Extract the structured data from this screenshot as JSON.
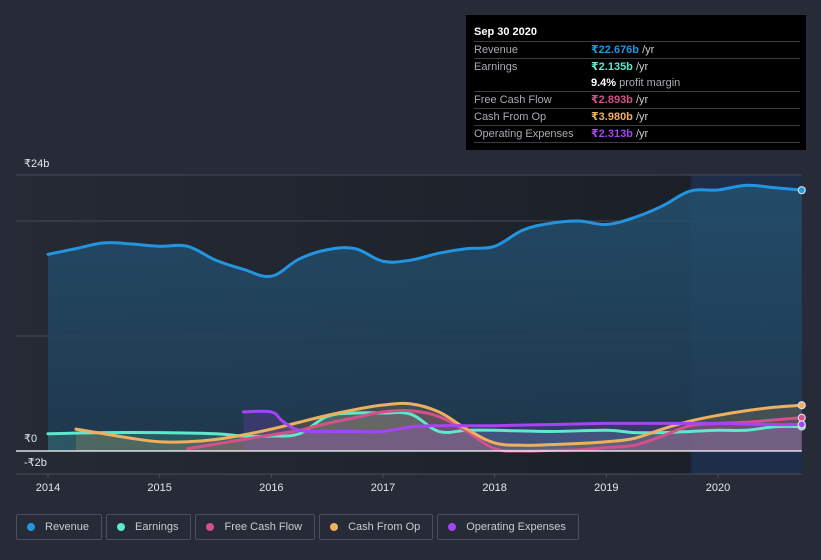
{
  "tooltip": {
    "date": "Sep 30 2020",
    "rows": [
      {
        "label": "Revenue",
        "value": "₹22.676b",
        "unit": " /yr",
        "color": "#2394df"
      },
      {
        "label": "Earnings",
        "value": "₹2.135b",
        "unit": " /yr",
        "color": "#5ee8cc"
      },
      {
        "label": "",
        "value": "9.4%",
        "unit": " profit margin",
        "color": "#ffffff"
      },
      {
        "label": "Free Cash Flow",
        "value": "₹2.893b",
        "unit": " /yr",
        "color": "#d3508d"
      },
      {
        "label": "Cash From Op",
        "value": "₹3.980b",
        "unit": " /yr",
        "color": "#eeaf5f"
      },
      {
        "label": "Operating Expenses",
        "value": "₹2.313b",
        "unit": " /yr",
        "color": "#a544f0"
      }
    ]
  },
  "legend": [
    {
      "label": "Revenue",
      "color": "#2394df"
    },
    {
      "label": "Earnings",
      "color": "#5ee8cc"
    },
    {
      "label": "Free Cash Flow",
      "color": "#d3508d"
    },
    {
      "label": "Cash From Op",
      "color": "#eeaf5f"
    },
    {
      "label": "Operating Expenses",
      "color": "#a544f0"
    }
  ],
  "chart_data": {
    "type": "area",
    "title": "",
    "xlabel": "",
    "ylabel": "",
    "ylim": [
      -2,
      24
    ],
    "xlim": [
      2013.9,
      2020.75
    ],
    "y_ticks": [
      {
        "value": 24,
        "label": "₹24b"
      },
      {
        "value": 0,
        "label": "₹0"
      },
      {
        "value": -2,
        "label": "-₹2b"
      }
    ],
    "x_ticks": [
      2014,
      2015,
      2016,
      2017,
      2018,
      2019,
      2020
    ],
    "x_tick_labels": [
      "2014",
      "2015",
      "2016",
      "2017",
      "2018",
      "2019",
      "2020"
    ],
    "gridlines": [
      10,
      20,
      24
    ],
    "highlight_from": 2019.75,
    "grid": true,
    "legend_position": "bottom-left",
    "series": [
      {
        "name": "Revenue",
        "color": "#2394df",
        "x": [
          2014.0,
          2014.25,
          2014.5,
          2014.75,
          2015.0,
          2015.25,
          2015.5,
          2015.75,
          2016.0,
          2016.25,
          2016.5,
          2016.75,
          2017.0,
          2017.25,
          2017.5,
          2017.75,
          2018.0,
          2018.25,
          2018.5,
          2018.75,
          2019.0,
          2019.25,
          2019.5,
          2019.75,
          2020.0,
          2020.25,
          2020.5,
          2020.75
        ],
        "y": [
          17.1,
          17.6,
          18.1,
          18.0,
          17.8,
          17.8,
          16.6,
          15.8,
          15.2,
          16.7,
          17.5,
          17.6,
          16.5,
          16.6,
          17.2,
          17.6,
          17.8,
          19.2,
          19.8,
          20.0,
          19.7,
          20.3,
          21.3,
          22.6,
          22.7,
          23.1,
          22.9,
          22.68
        ]
      },
      {
        "name": "Earnings",
        "color": "#5ee8cc",
        "x": [
          2014.0,
          2014.5,
          2015.0,
          2015.5,
          2015.75,
          2016.0,
          2016.25,
          2016.5,
          2016.75,
          2017.0,
          2017.25,
          2017.5,
          2017.75,
          2018.0,
          2018.5,
          2019.0,
          2019.25,
          2019.5,
          2019.75,
          2020.0,
          2020.25,
          2020.5,
          2020.75
        ],
        "y": [
          1.5,
          1.6,
          1.6,
          1.5,
          1.3,
          1.3,
          1.5,
          3.0,
          3.3,
          3.3,
          3.2,
          1.7,
          1.8,
          1.8,
          1.7,
          1.8,
          1.6,
          1.6,
          1.7,
          1.8,
          1.8,
          2.1,
          2.135
        ]
      },
      {
        "name": "Free Cash Flow",
        "color": "#d3508d",
        "x": [
          2015.25,
          2015.5,
          2015.75,
          2016.0,
          2016.25,
          2016.5,
          2016.75,
          2017.0,
          2017.25,
          2017.5,
          2017.75,
          2018.0,
          2018.25,
          2018.5,
          2018.75,
          2019.0,
          2019.25,
          2019.5,
          2019.75,
          2020.0,
          2020.25,
          2020.5,
          2020.75
        ],
        "y": [
          0.2,
          0.6,
          1.0,
          1.4,
          1.8,
          2.4,
          2.9,
          3.4,
          3.5,
          3.0,
          1.7,
          0.2,
          0.0,
          0.05,
          0.1,
          0.3,
          0.5,
          1.3,
          2.2,
          2.4,
          2.5,
          2.7,
          2.893
        ]
      },
      {
        "name": "Cash From Op",
        "color": "#eeaf5f",
        "x": [
          2014.25,
          2014.5,
          2014.75,
          2015.0,
          2015.25,
          2015.5,
          2015.75,
          2016.0,
          2016.25,
          2016.5,
          2016.75,
          2017.0,
          2017.25,
          2017.5,
          2017.75,
          2018.0,
          2018.25,
          2018.5,
          2018.75,
          2019.0,
          2019.25,
          2019.5,
          2019.75,
          2020.0,
          2020.25,
          2020.5,
          2020.75
        ],
        "y": [
          1.9,
          1.5,
          1.1,
          0.8,
          0.8,
          1.0,
          1.4,
          1.9,
          2.5,
          3.1,
          3.6,
          4.0,
          4.1,
          3.4,
          1.9,
          0.7,
          0.5,
          0.55,
          0.65,
          0.8,
          1.1,
          1.9,
          2.6,
          3.1,
          3.5,
          3.8,
          3.98
        ]
      },
      {
        "name": "Operating Expenses",
        "color": "#a544f0",
        "x": [
          2015.75,
          2016.0,
          2016.1,
          2016.25,
          2016.5,
          2016.75,
          2017.0,
          2017.25,
          2017.5,
          2017.75,
          2018.0,
          2018.5,
          2019.0,
          2019.5,
          2019.75,
          2020.0,
          2020.25,
          2020.5,
          2020.75
        ],
        "y": [
          3.4,
          3.4,
          2.6,
          1.8,
          1.7,
          1.7,
          1.7,
          2.1,
          2.2,
          2.2,
          2.2,
          2.3,
          2.4,
          2.4,
          2.4,
          2.4,
          2.35,
          2.3,
          2.313
        ]
      }
    ]
  }
}
